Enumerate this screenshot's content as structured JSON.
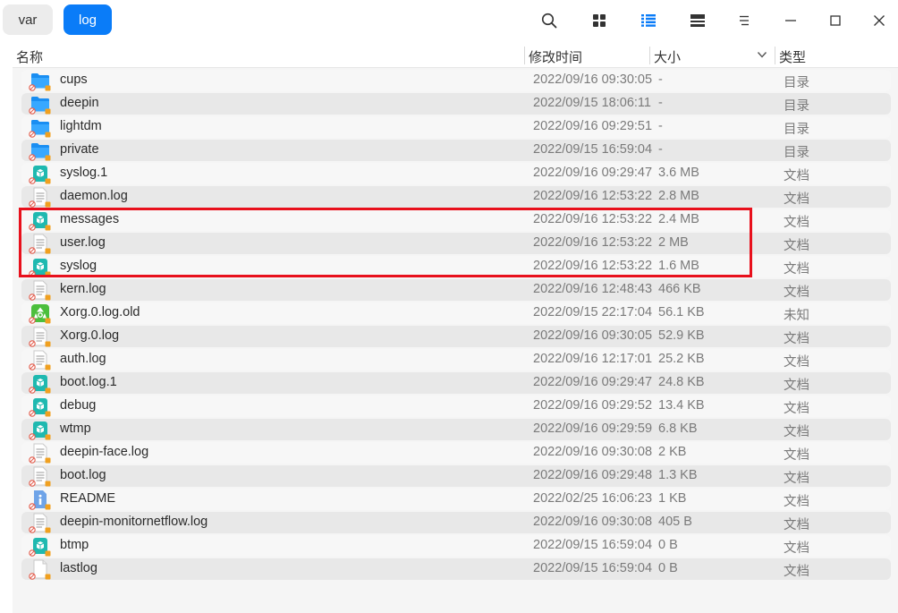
{
  "breadcrumbs": [
    "var",
    "log"
  ],
  "toolbar": {
    "search_icon": "search-icon",
    "icon_view": "grid-view-icon",
    "list_view": "list-view-icon",
    "tree_view": "split-view-icon",
    "menu": "menu-icon"
  },
  "colors": {
    "accent": "#0a7cf8",
    "highlight": "#e8101c"
  },
  "columns": {
    "name": "名称",
    "modified": "修改时间",
    "size": "大小",
    "type": "类型"
  },
  "files": [
    {
      "name": "cups",
      "date": "2022/09/16 09:30:05",
      "size": "-",
      "type": "目录",
      "icon": "folder"
    },
    {
      "name": "deepin",
      "date": "2022/09/15 18:06:11",
      "size": "-",
      "type": "目录",
      "icon": "folder"
    },
    {
      "name": "lightdm",
      "date": "2022/09/16 09:29:51",
      "size": "-",
      "type": "目录",
      "icon": "folder"
    },
    {
      "name": "private",
      "date": "2022/09/15 16:59:04",
      "size": "-",
      "type": "目录",
      "icon": "folder"
    },
    {
      "name": "syslog.1",
      "date": "2022/09/16 09:29:47",
      "size": "3.6 MB",
      "type": "文档",
      "icon": "package"
    },
    {
      "name": "daemon.log",
      "date": "2022/09/16 12:53:22",
      "size": "2.8 MB",
      "type": "文档",
      "icon": "text"
    },
    {
      "name": "messages",
      "date": "2022/09/16 12:53:22",
      "size": "2.4 MB",
      "type": "文档",
      "icon": "package"
    },
    {
      "name": "user.log",
      "date": "2022/09/16 12:53:22",
      "size": "2 MB",
      "type": "文档",
      "icon": "text"
    },
    {
      "name": "syslog",
      "date": "2022/09/16 12:53:22",
      "size": "1.6 MB",
      "type": "文档",
      "icon": "package"
    },
    {
      "name": "kern.log",
      "date": "2022/09/16 12:48:43",
      "size": "466 KB",
      "type": "文档",
      "icon": "text"
    },
    {
      "name": "Xorg.0.log.old",
      "date": "2022/09/15 22:17:04",
      "size": "56.1 KB",
      "type": "未知",
      "icon": "recycle"
    },
    {
      "name": "Xorg.0.log",
      "date": "2022/09/16 09:30:05",
      "size": "52.9 KB",
      "type": "文档",
      "icon": "text"
    },
    {
      "name": "auth.log",
      "date": "2022/09/16 12:17:01",
      "size": "25.2 KB",
      "type": "文档",
      "icon": "text"
    },
    {
      "name": "boot.log.1",
      "date": "2022/09/16 09:29:47",
      "size": "24.8 KB",
      "type": "文档",
      "icon": "package"
    },
    {
      "name": "debug",
      "date": "2022/09/16 09:29:52",
      "size": "13.4 KB",
      "type": "文档",
      "icon": "package"
    },
    {
      "name": "wtmp",
      "date": "2022/09/16 09:29:59",
      "size": "6.8 KB",
      "type": "文档",
      "icon": "package"
    },
    {
      "name": "deepin-face.log",
      "date": "2022/09/16 09:30:08",
      "size": "2 KB",
      "type": "文档",
      "icon": "text"
    },
    {
      "name": "boot.log",
      "date": "2022/09/16 09:29:48",
      "size": "1.3 KB",
      "type": "文档",
      "icon": "text"
    },
    {
      "name": "README",
      "date": "2022/02/25 16:06:23",
      "size": "1 KB",
      "type": "文档",
      "icon": "info"
    },
    {
      "name": "deepin-monitornetflow.log",
      "date": "2022/09/16 09:30:08",
      "size": "405 B",
      "type": "文档",
      "icon": "text"
    },
    {
      "name": "btmp",
      "date": "2022/09/15 16:59:04",
      "size": "0 B",
      "type": "文档",
      "icon": "package"
    },
    {
      "name": "lastlog",
      "date": "2022/09/15 16:59:04",
      "size": "0 B",
      "type": "文档",
      "icon": "blank"
    }
  ]
}
